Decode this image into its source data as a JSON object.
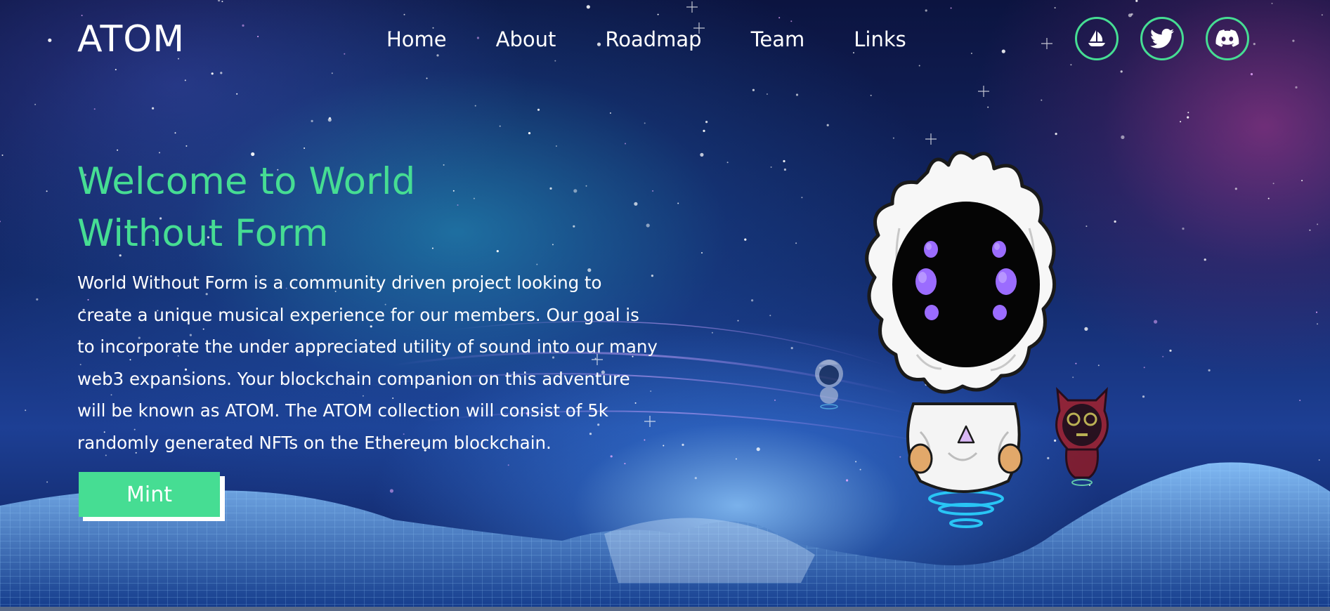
{
  "brand": {
    "logo": "ATOM"
  },
  "nav": {
    "items": [
      {
        "label": "Home"
      },
      {
        "label": "About"
      },
      {
        "label": "Roadmap"
      },
      {
        "label": "Team"
      },
      {
        "label": "Links"
      }
    ]
  },
  "socials": [
    {
      "icon": "opensea-sailboat-icon"
    },
    {
      "icon": "twitter-bird-icon"
    },
    {
      "icon": "discord-icon"
    }
  ],
  "hero": {
    "title_line1": "Welcome to World",
    "title_line2": "Without Form",
    "description": "World Without Form is a community driven project looking to create a unique musical experience for our members. Our goal is to incorporate the under appreciated utility of sound into our many web3 expansions. Your blockchain companion on this adventure will be known as ATOM. The ATOM collection will consist of 5k randomly generated NFTs on the Ethereum blockchain.",
    "cta_label": "Mint"
  },
  "colors": {
    "accent": "#46dd93",
    "text": "#ffffff",
    "background": "#132a6b"
  }
}
